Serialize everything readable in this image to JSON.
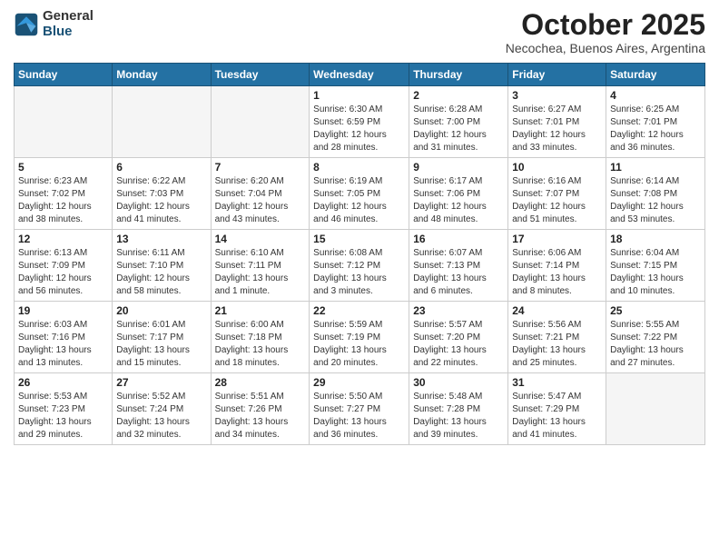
{
  "logo": {
    "general": "General",
    "blue": "Blue"
  },
  "title": "October 2025",
  "location": "Necochea, Buenos Aires, Argentina",
  "weekdays": [
    "Sunday",
    "Monday",
    "Tuesday",
    "Wednesday",
    "Thursday",
    "Friday",
    "Saturday"
  ],
  "weeks": [
    [
      {
        "day": "",
        "info": ""
      },
      {
        "day": "",
        "info": ""
      },
      {
        "day": "",
        "info": ""
      },
      {
        "day": "1",
        "info": "Sunrise: 6:30 AM\nSunset: 6:59 PM\nDaylight: 12 hours\nand 28 minutes."
      },
      {
        "day": "2",
        "info": "Sunrise: 6:28 AM\nSunset: 7:00 PM\nDaylight: 12 hours\nand 31 minutes."
      },
      {
        "day": "3",
        "info": "Sunrise: 6:27 AM\nSunset: 7:01 PM\nDaylight: 12 hours\nand 33 minutes."
      },
      {
        "day": "4",
        "info": "Sunrise: 6:25 AM\nSunset: 7:01 PM\nDaylight: 12 hours\nand 36 minutes."
      }
    ],
    [
      {
        "day": "5",
        "info": "Sunrise: 6:23 AM\nSunset: 7:02 PM\nDaylight: 12 hours\nand 38 minutes."
      },
      {
        "day": "6",
        "info": "Sunrise: 6:22 AM\nSunset: 7:03 PM\nDaylight: 12 hours\nand 41 minutes."
      },
      {
        "day": "7",
        "info": "Sunrise: 6:20 AM\nSunset: 7:04 PM\nDaylight: 12 hours\nand 43 minutes."
      },
      {
        "day": "8",
        "info": "Sunrise: 6:19 AM\nSunset: 7:05 PM\nDaylight: 12 hours\nand 46 minutes."
      },
      {
        "day": "9",
        "info": "Sunrise: 6:17 AM\nSunset: 7:06 PM\nDaylight: 12 hours\nand 48 minutes."
      },
      {
        "day": "10",
        "info": "Sunrise: 6:16 AM\nSunset: 7:07 PM\nDaylight: 12 hours\nand 51 minutes."
      },
      {
        "day": "11",
        "info": "Sunrise: 6:14 AM\nSunset: 7:08 PM\nDaylight: 12 hours\nand 53 minutes."
      }
    ],
    [
      {
        "day": "12",
        "info": "Sunrise: 6:13 AM\nSunset: 7:09 PM\nDaylight: 12 hours\nand 56 minutes."
      },
      {
        "day": "13",
        "info": "Sunrise: 6:11 AM\nSunset: 7:10 PM\nDaylight: 12 hours\nand 58 minutes."
      },
      {
        "day": "14",
        "info": "Sunrise: 6:10 AM\nSunset: 7:11 PM\nDaylight: 13 hours\nand 1 minute."
      },
      {
        "day": "15",
        "info": "Sunrise: 6:08 AM\nSunset: 7:12 PM\nDaylight: 13 hours\nand 3 minutes."
      },
      {
        "day": "16",
        "info": "Sunrise: 6:07 AM\nSunset: 7:13 PM\nDaylight: 13 hours\nand 6 minutes."
      },
      {
        "day": "17",
        "info": "Sunrise: 6:06 AM\nSunset: 7:14 PM\nDaylight: 13 hours\nand 8 minutes."
      },
      {
        "day": "18",
        "info": "Sunrise: 6:04 AM\nSunset: 7:15 PM\nDaylight: 13 hours\nand 10 minutes."
      }
    ],
    [
      {
        "day": "19",
        "info": "Sunrise: 6:03 AM\nSunset: 7:16 PM\nDaylight: 13 hours\nand 13 minutes."
      },
      {
        "day": "20",
        "info": "Sunrise: 6:01 AM\nSunset: 7:17 PM\nDaylight: 13 hours\nand 15 minutes."
      },
      {
        "day": "21",
        "info": "Sunrise: 6:00 AM\nSunset: 7:18 PM\nDaylight: 13 hours\nand 18 minutes."
      },
      {
        "day": "22",
        "info": "Sunrise: 5:59 AM\nSunset: 7:19 PM\nDaylight: 13 hours\nand 20 minutes."
      },
      {
        "day": "23",
        "info": "Sunrise: 5:57 AM\nSunset: 7:20 PM\nDaylight: 13 hours\nand 22 minutes."
      },
      {
        "day": "24",
        "info": "Sunrise: 5:56 AM\nSunset: 7:21 PM\nDaylight: 13 hours\nand 25 minutes."
      },
      {
        "day": "25",
        "info": "Sunrise: 5:55 AM\nSunset: 7:22 PM\nDaylight: 13 hours\nand 27 minutes."
      }
    ],
    [
      {
        "day": "26",
        "info": "Sunrise: 5:53 AM\nSunset: 7:23 PM\nDaylight: 13 hours\nand 29 minutes."
      },
      {
        "day": "27",
        "info": "Sunrise: 5:52 AM\nSunset: 7:24 PM\nDaylight: 13 hours\nand 32 minutes."
      },
      {
        "day": "28",
        "info": "Sunrise: 5:51 AM\nSunset: 7:26 PM\nDaylight: 13 hours\nand 34 minutes."
      },
      {
        "day": "29",
        "info": "Sunrise: 5:50 AM\nSunset: 7:27 PM\nDaylight: 13 hours\nand 36 minutes."
      },
      {
        "day": "30",
        "info": "Sunrise: 5:48 AM\nSunset: 7:28 PM\nDaylight: 13 hours\nand 39 minutes."
      },
      {
        "day": "31",
        "info": "Sunrise: 5:47 AM\nSunset: 7:29 PM\nDaylight: 13 hours\nand 41 minutes."
      },
      {
        "day": "",
        "info": ""
      }
    ]
  ]
}
